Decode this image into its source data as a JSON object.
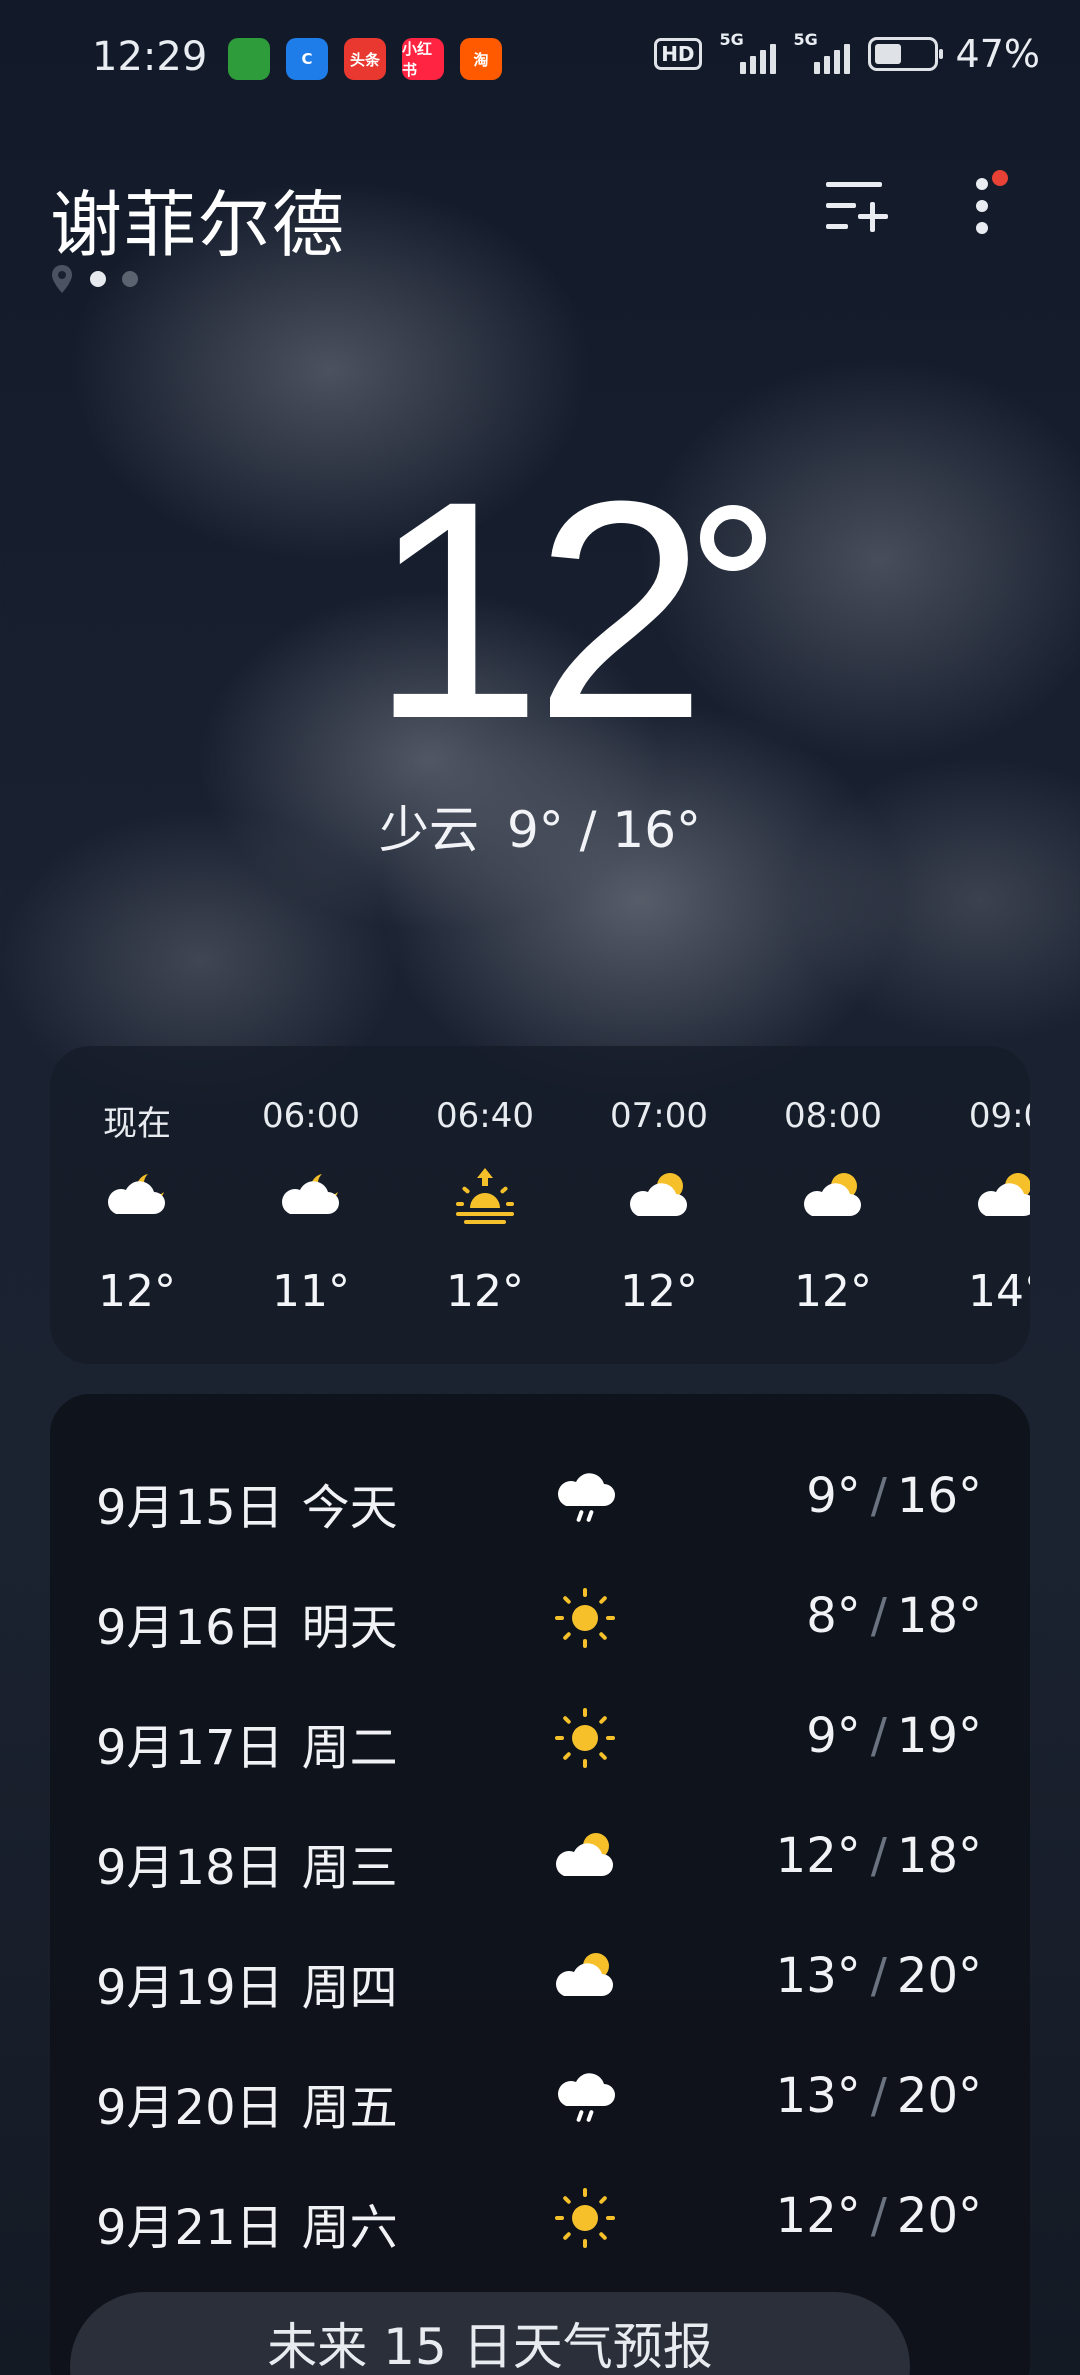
{
  "status_bar": {
    "time": "12:29",
    "hd_label": "HD",
    "signal1_label": "5G",
    "signal2_label": "5G",
    "battery_percent": "47%",
    "battery_level": 0.47,
    "app_icons": [
      {
        "name": "game-app-icon",
        "text": "",
        "color": "#2e9c3a"
      },
      {
        "name": "browser-app-icon",
        "text": "C",
        "color": "#1e7de8"
      },
      {
        "name": "toutiao-app-icon",
        "text": "头条",
        "color": "#e8382f"
      },
      {
        "name": "xiaohongshu-app-icon",
        "text": "小红书",
        "color": "#ff2442"
      },
      {
        "name": "taobao-app-icon",
        "text": "淘",
        "color": "#ff5a00"
      }
    ]
  },
  "header": {
    "city": "谢菲尔德"
  },
  "current": {
    "temperature": "12",
    "condition": "少云",
    "range": "9° / 16°"
  },
  "hourly": [
    {
      "label": "现在",
      "icon": "partly-cloudy-night-icon",
      "temp": "12°"
    },
    {
      "label": "06:00",
      "icon": "partly-cloudy-night-icon",
      "temp": "11°"
    },
    {
      "label": "06:40",
      "icon": "sunrise-icon",
      "temp": "12°"
    },
    {
      "label": "07:00",
      "icon": "partly-cloudy-day-icon",
      "temp": "12°"
    },
    {
      "label": "08:00",
      "icon": "partly-cloudy-day-icon",
      "temp": "12°"
    },
    {
      "label": "09:0",
      "icon": "partly-cloudy-day-icon",
      "temp": "14°"
    }
  ],
  "daily": [
    {
      "date": "9月15日",
      "day": "今天",
      "icon": "rain-icon",
      "low": "9°",
      "high": "16°"
    },
    {
      "date": "9月16日",
      "day": "明天",
      "icon": "sunny-icon",
      "low": "8°",
      "high": "18°"
    },
    {
      "date": "9月17日",
      "day": "周二",
      "icon": "sunny-icon",
      "low": "9°",
      "high": "19°"
    },
    {
      "date": "9月18日",
      "day": "周三",
      "icon": "partly-cloudy-day-icon",
      "low": "12°",
      "high": "18°"
    },
    {
      "date": "9月19日",
      "day": "周四",
      "icon": "partly-cloudy-day-icon",
      "low": "13°",
      "high": "20°"
    },
    {
      "date": "9月20日",
      "day": "周五",
      "icon": "rain-icon",
      "low": "13°",
      "high": "20°"
    },
    {
      "date": "9月21日",
      "day": "周六",
      "icon": "sunny-icon",
      "low": "12°",
      "high": "20°"
    }
  ],
  "forecast_button": "未来 15 日天气预报",
  "colors": {
    "sun": "#f5c02a",
    "cloud": "#ffffff",
    "rain": "#b8c2d0",
    "alert_dot": "#e84136"
  }
}
